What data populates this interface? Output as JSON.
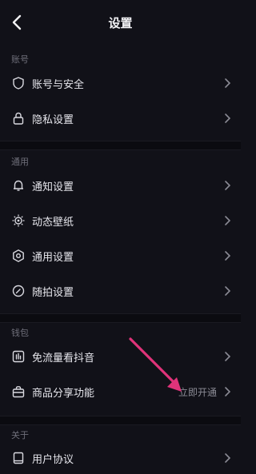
{
  "header": {
    "title": "设置"
  },
  "sections": [
    {
      "label": "账号",
      "items": [
        {
          "label": "账号与安全",
          "icon": "shield-icon"
        },
        {
          "label": "隐私设置",
          "icon": "lock-icon"
        }
      ]
    },
    {
      "label": "通用",
      "items": [
        {
          "label": "通知设置",
          "icon": "bell-icon"
        },
        {
          "label": "动态壁纸",
          "icon": "wallpaper-icon"
        },
        {
          "label": "通用设置",
          "icon": "gear-icon"
        },
        {
          "label": "随拍设置",
          "icon": "camera-icon"
        }
      ]
    },
    {
      "label": "钱包",
      "items": [
        {
          "label": "免流量看抖音",
          "icon": "data-icon"
        },
        {
          "label": "商品分享功能",
          "icon": "bag-icon",
          "extra": "立即开通"
        }
      ]
    },
    {
      "label": "关于",
      "items": [
        {
          "label": "用户协议",
          "icon": "document-icon"
        }
      ]
    }
  ],
  "colors": {
    "annotation_arrow": "#e0337a",
    "background": "#111118"
  }
}
